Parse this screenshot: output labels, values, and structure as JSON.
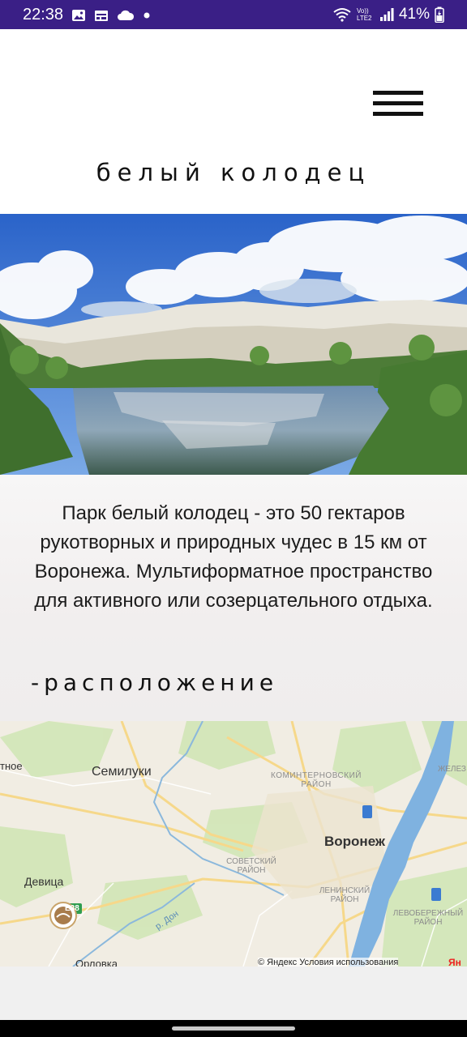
{
  "status_bar": {
    "time": "22:38",
    "network_label": "Vo)) LTE2",
    "battery": "41%",
    "icons": [
      "image-icon",
      "calendar-icon",
      "cloud-icon",
      "dot-icon",
      "wifi-icon",
      "signal-icon",
      "battery-icon"
    ]
  },
  "header": {
    "title": "белый колодец",
    "menu_icon": "hamburger-icon"
  },
  "content": {
    "description": "Парк белый колодец - это 50 гектаров рукотворных и природных чудес в 15 км от Воронежа. Мультиформатное пространство для активного или созерцательного отдыха.",
    "section_title": "-расположение"
  },
  "map": {
    "labels": {
      "city_main": "Воронеж",
      "semiluki": "Семилуки",
      "komintern": "КОМИНТЕРНОВСКИЙ РАЙОН",
      "sovetsky": "СОВЕТСКИЙ РАЙОН",
      "leninsky": "ЛЕНИНСКИЙ РАЙОН",
      "levoberezh": "ЛЕВОБЕРЕЖНЫЙ РАЙОН",
      "zhelez": "ЖЕЛЕЗ",
      "devitsa": "Девица",
      "orlovka": "Орловка",
      "left_edge": "тное",
      "river": "р. Дон",
      "road": "E38",
      "yandex_cut": "Ян"
    },
    "attribution": "© Яндекс Условия использования"
  }
}
